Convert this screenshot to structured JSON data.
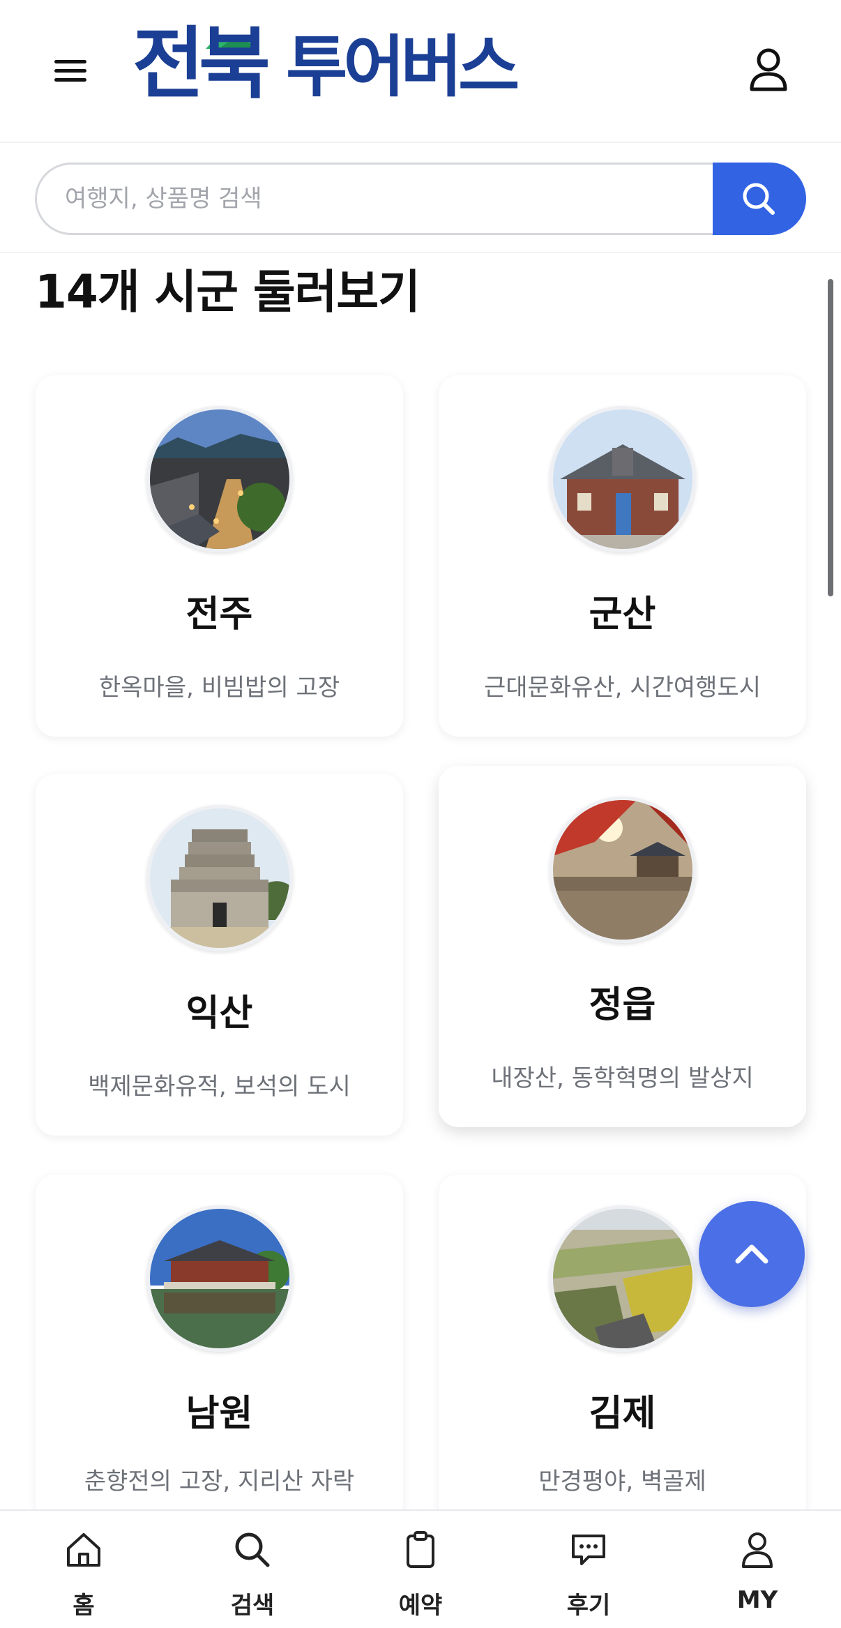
{
  "header": {
    "logo_main": "전북",
    "logo_sub": "투어버스"
  },
  "search": {
    "placeholder": "여행지, 상품명 검색"
  },
  "section": {
    "title": "14개 시군 둘러보기"
  },
  "cities": [
    {
      "name": "전주",
      "desc": "한옥마을, 비빔밥의 고장"
    },
    {
      "name": "군산",
      "desc": "근대문화유산, 시간여행도시"
    },
    {
      "name": "익산",
      "desc": "백제문화유적, 보석의 도시"
    },
    {
      "name": "정읍",
      "desc": "내장산, 동학혁명의 발상지"
    },
    {
      "name": "남원",
      "desc": "춘향전의 고장, 지리산 자락"
    },
    {
      "name": "김제",
      "desc": "만경평야, 벽골제"
    }
  ],
  "bottom_nav": [
    {
      "label": "홈",
      "icon": "home-icon"
    },
    {
      "label": "검색",
      "icon": "search-icon"
    },
    {
      "label": "예약",
      "icon": "clipboard-icon"
    },
    {
      "label": "후기",
      "icon": "chat-icon"
    },
    {
      "label": "MY",
      "icon": "user-icon"
    }
  ],
  "colors": {
    "brand": "#1b3f94",
    "accent": "#3163e3"
  }
}
